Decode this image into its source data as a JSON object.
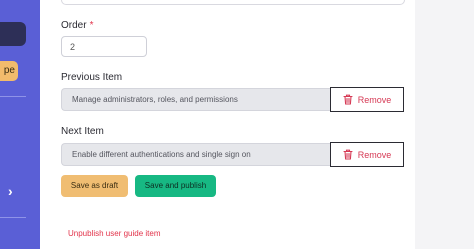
{
  "sidebar": {
    "yellow_chip_text": "pe",
    "chevron": "›"
  },
  "form": {
    "order": {
      "label": "Order",
      "required_mark": "*",
      "value": "2"
    },
    "previous_item": {
      "label": "Previous Item",
      "value": "Manage administrators, roles, and permissions",
      "remove_label": "Remove"
    },
    "next_item": {
      "label": "Next Item",
      "value": "Enable different authentications and single sign on",
      "remove_label": "Remove"
    }
  },
  "actions": {
    "save_draft": "Save as draft",
    "save_publish": "Save and publish",
    "unpublish": "Unpublish user guide item"
  },
  "colors": {
    "sidebar": "#5a5fd6",
    "draft_button": "#f0bd72",
    "publish_button": "#17b883",
    "danger": "#d63a55"
  },
  "icons": {
    "remove": "trash-icon",
    "sidebar_expand": "chevron-right-icon"
  }
}
